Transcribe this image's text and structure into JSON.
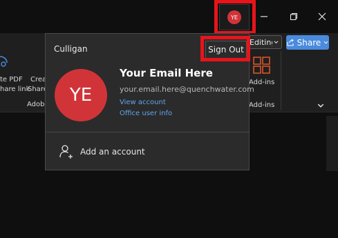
{
  "titlebar": {
    "avatar_initials": "YE",
    "minimize_icon": "minimize-icon",
    "restore_icon": "restore-icon",
    "close_icon": "close-icon"
  },
  "ribbon": {
    "editing_label": "Editing",
    "share_label": "Share",
    "left_button1_line1": "te PDF",
    "left_button1_line2": "hare link",
    "left_button2_line1": "Crea",
    "left_button2_line2": "Share",
    "group_label_left": "Adob",
    "addins_button_label": "Add-ins",
    "addins_group_label": "Add-ins"
  },
  "account_popup": {
    "org_name": "Culligan",
    "sign_out_label": "Sign Out",
    "avatar_initials": "YE",
    "user_name": "Your Email Here",
    "user_email": "your.email.here@quenchwater.com",
    "view_account_label": "View account",
    "office_user_info_label": "Office user info",
    "add_account_label": "Add an account"
  },
  "colors": {
    "avatar_red": "#d13438",
    "highlight_red": "#e8141b",
    "link_blue": "#5ea6ee",
    "share_blue": "#4a8bdd"
  }
}
